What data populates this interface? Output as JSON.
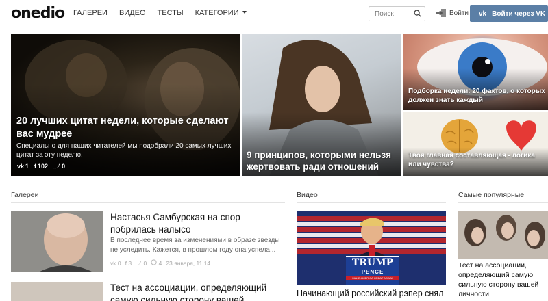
{
  "header": {
    "logo": "onedio",
    "nav": [
      "ГАЛЕРЕИ",
      "ВИДЕО",
      "ТЕСТЫ",
      "КАТЕГОРИИ"
    ],
    "search_placeholder": "Поиск",
    "login_label": "Войти",
    "vk_button_label": "Войти через VK",
    "vk_badge": "vk"
  },
  "hero": [
    {
      "title": "20 лучших цитат недели, которые сделают вас мудрее",
      "description": "Специально для наших читателей мы подобрали 20 самых лучших цитат за эту неделю.",
      "stats": {
        "vk": "1",
        "fb": "102",
        "tw": "0"
      }
    },
    {
      "title": "9 принципов, которыми нельзя жертвовать ради отношений"
    },
    {
      "title": "Подборка недели: 20 фактов, о которых должен знать каждый"
    },
    {
      "title": "Твоя главная составляющая - логика или чувства?"
    }
  ],
  "sections": {
    "galleries": "Галереи",
    "video": "Видео",
    "popular": "Самые популярные"
  },
  "gallery_articles": [
    {
      "title": "Настасья Самбурская на спор побрилась налысо",
      "description": "В последнее время за изменениями в образе звезды не уследить. Кажется, в прошлом году она успела...",
      "stats": {
        "vk": "0",
        "fb": "3",
        "tw": "0",
        "comments": "4",
        "date": "23 января, 11:14"
      }
    },
    {
      "title": "Тест на ассоциации, определяющий самую сильную сторону вашей"
    }
  ],
  "video_article": {
    "title": "Начинающий российский рэпер снял клип о Трампе",
    "sign_main": "TRUMP",
    "sign_sub": "PENCE",
    "sign_slogan": "MAKE AMERICA GREAT AGAIN!"
  },
  "popular_article": {
    "title": "Тест на ассоциации, определяющий самую сильную сторону вашей личности"
  },
  "colors": {
    "vk_blue": "#5b7fa6",
    "accent_red": "#e53935"
  }
}
